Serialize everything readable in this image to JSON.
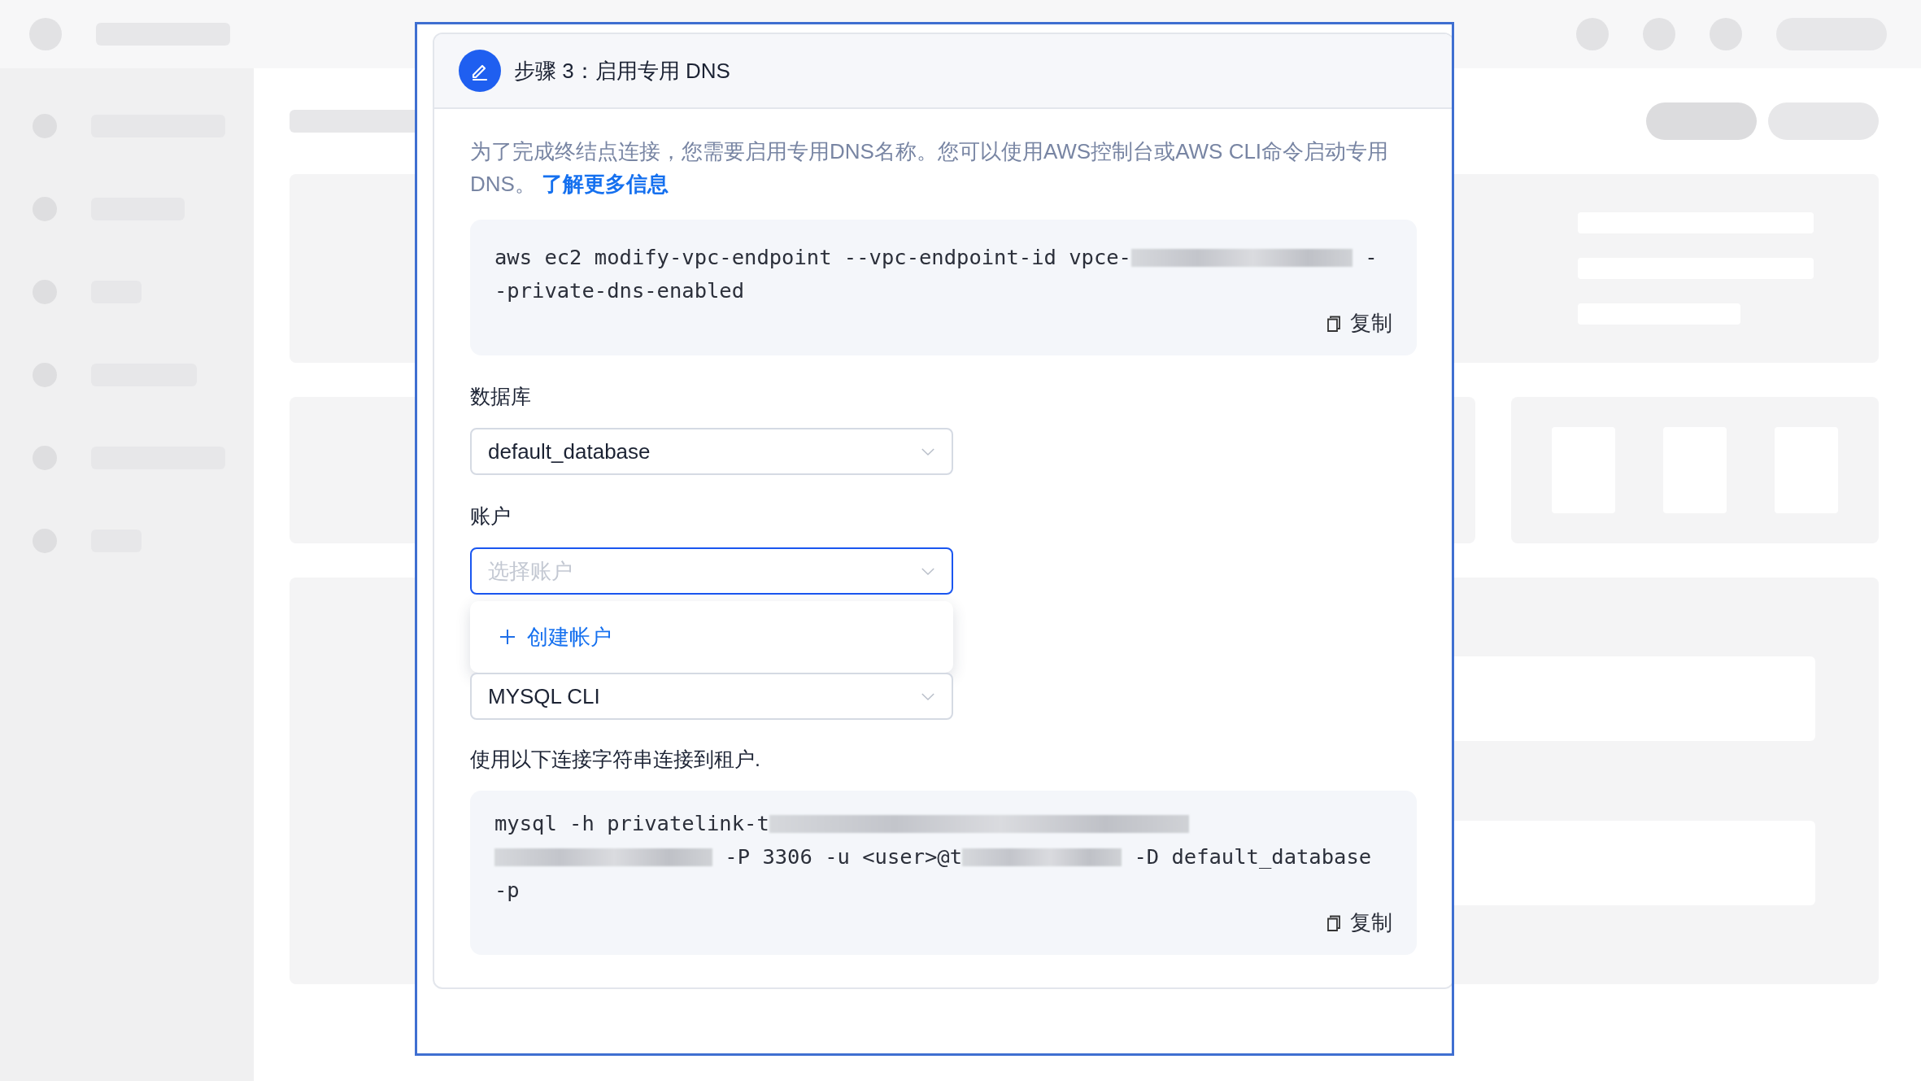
{
  "dialog": {
    "step_title": "步骤 3：启用专用 DNS",
    "description": {
      "text": "为了完成终结点连接，您需要启用专用DNS名称。您可以使用AWS控制台或AWS CLI命令启动专用DNS。",
      "link": "了解更多信息"
    },
    "command_block": {
      "lines": [
        [
          {
            "kind": "text",
            "text": "aws ec2 modify-vpc-endpoint --vpc-endpoint-id vpce-"
          },
          {
            "kind": "redacted"
          },
          {
            "kind": "text",
            "text": " -"
          }
        ],
        [
          {
            "kind": "text",
            "text": "-private-dns-enabled"
          }
        ]
      ],
      "copy_label": "复制"
    },
    "fields": [
      {
        "label": "数据库",
        "value": "default_database",
        "focused": false
      },
      {
        "label": "账户",
        "placeholder": "选择账户",
        "focused": true,
        "menu": [
          {
            "kind": "create",
            "label": "创建帐户"
          }
        ]
      },
      {
        "value": "MYSQL CLI",
        "focused": false
      }
    ],
    "connection_hint": "使用以下连接字符串连接到租户.",
    "connection_block": {
      "lines": [
        [
          {
            "kind": "text",
            "text": "mysql -h privatelink-t"
          },
          {
            "kind": "redacted"
          }
        ],
        [
          {
            "kind": "redacted"
          },
          {
            "kind": "text",
            "text": " -P 3306 -u <user>@t"
          },
          {
            "kind": "redacted"
          },
          {
            "kind": "text",
            "text": " -D default_database"
          }
        ],
        [
          {
            "kind": "text",
            "text": "-p"
          }
        ]
      ],
      "copy_label": "复制"
    }
  }
}
